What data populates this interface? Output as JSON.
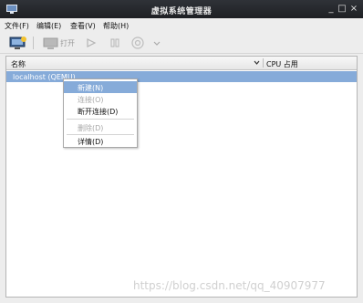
{
  "window": {
    "title": "虚拟系统管理器",
    "minimize": "_",
    "maximize": "□",
    "close": "×"
  },
  "menubar": [
    "文件(F)",
    "编辑(E)",
    "查看(V)",
    "帮助(H)"
  ],
  "toolbar": {
    "open_label": "打开"
  },
  "list": {
    "col_name": "名称",
    "col_cpu": "CPU 占用",
    "rows": [
      {
        "name": "localhost (QEMU)"
      }
    ]
  },
  "context_menu": {
    "items": [
      {
        "label": "新建(N)",
        "state": "highlighted"
      },
      {
        "label": "连接(O)",
        "state": "disabled"
      },
      {
        "label": "断开连接(D)",
        "state": "enabled"
      },
      {
        "label": "删除(D)",
        "state": "disabled"
      },
      {
        "label": "详情(D)",
        "state": "enabled"
      }
    ]
  },
  "watermark": "https://blog.csdn.net/qq_40907977",
  "colors": {
    "selection": "#86abd9",
    "titlebar": "#25282d"
  },
  "icons": [
    "monitor-icon",
    "new-vm-icon",
    "open-vm-icon",
    "play-icon",
    "pause-icon",
    "power-icon",
    "chevron-down-icon"
  ]
}
